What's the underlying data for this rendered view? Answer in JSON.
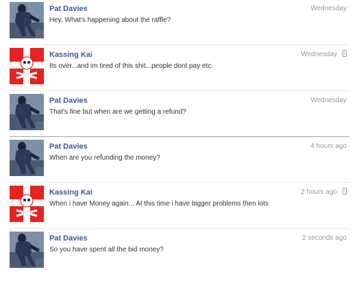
{
  "messages": [
    {
      "sender": "Pat Davies",
      "text": "Hey, What's happening about the raffle?",
      "time": "Wednesday",
      "avatar": "pat-davies-avatar",
      "mobile": false
    },
    {
      "sender": "Kassing Kai",
      "text": "Its over...and im tired of this shit...people dont pay etc.",
      "time": "Wednesday",
      "avatar": "pirate-flag-avatar",
      "mobile": true
    },
    {
      "sender": "Pat Davies",
      "text": "That's fine but when are we getting a refund?",
      "time": "Wednesday",
      "avatar": "pat-davies-avatar",
      "mobile": false
    },
    {
      "sender": "Pat Davies",
      "text": "When are you refunding the money?",
      "time": "4 hours ago",
      "avatar": "pat-davies-avatar",
      "mobile": false
    },
    {
      "sender": "Kassing Kai",
      "text": "When i have Money again... At this time i have bigger problems then lots",
      "time": "2 hours ago",
      "avatar": "pirate-flag-avatar",
      "mobile": true
    },
    {
      "sender": "Pat Davies",
      "text": "So you have spent all the bid money?",
      "time": "2 seconds ago",
      "avatar": "pat-davies-avatar",
      "mobile": false
    }
  ],
  "colors": {
    "name": "#3b5998",
    "text": "#333333",
    "time": "#999999",
    "pirate_red": "#e8221e"
  }
}
